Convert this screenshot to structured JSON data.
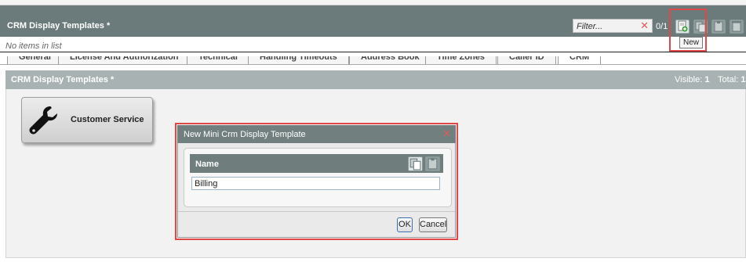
{
  "top_panel": {
    "title": "CRM Display Templates *",
    "filter_placeholder": "Filter...",
    "counter": "0/1",
    "empty_text": "No items in list",
    "tooltip": "New"
  },
  "toolbar_icons": [
    "new-template-icon",
    "copy-icon",
    "paste-icon",
    "delete-icon"
  ],
  "tabs": [
    "General",
    "License And Authorization",
    "Technical",
    "Handling Timeouts",
    "Address Book",
    "Time Zones",
    "Caller ID",
    "CRM"
  ],
  "panel": {
    "title": "CRM Display Templates *",
    "visible_label": "Visible:",
    "visible_value": "1",
    "total_label": "Total:",
    "total_value": "1"
  },
  "template_tile": {
    "label": "Customer Service",
    "icon": "wrench-icon"
  },
  "dialog": {
    "title": "New Mini Crm Display Template",
    "field_label": "Name",
    "field_value": "Billing",
    "ok_label": "OK",
    "cancel_label": "Cancel"
  },
  "colors": {
    "header": "#6b7b7b",
    "panel_header": "#a9b2b2",
    "highlight": "#e04848",
    "clear_x": "#e35a5a"
  }
}
